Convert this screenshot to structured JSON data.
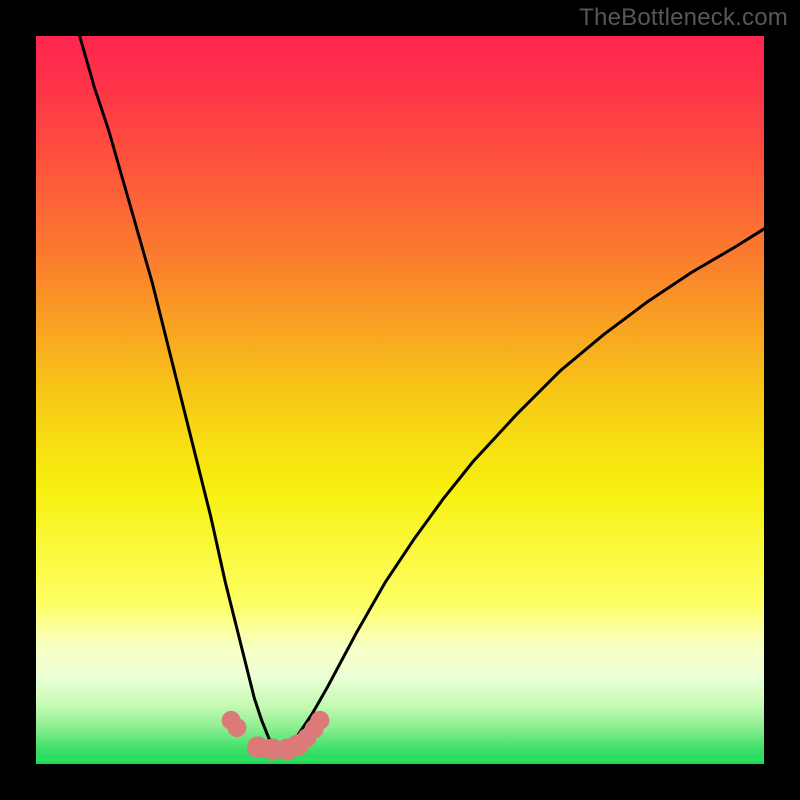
{
  "watermark": "TheBottleneck.com",
  "colors": {
    "frame": "#000000",
    "curve": "#000000",
    "overlay_pink": "#DB7A79",
    "green_line": "#2EE062"
  },
  "chart_data": {
    "type": "line",
    "title": "",
    "xlabel": "",
    "ylabel": "",
    "x_range": [
      0,
      100
    ],
    "y_range": [
      0,
      100
    ],
    "notes": "Bottleneck-style V curve: steep descent from upper-left toward a minimum around x≈33, then logarithmic-like rise toward right. Background is a vertical gradient from red/pink (top, high bottleneck) through yellow (mid) to green (bottom, low bottleneck). Pink markers cluster near curve bottom; thin bright green line sits at the very bottom.",
    "background_gradient_stops": [
      {
        "offset": 0.0,
        "color": "#FF2650"
      },
      {
        "offset": 0.07,
        "color": "#FF3349"
      },
      {
        "offset": 0.3,
        "color": "#FB7B2E"
      },
      {
        "offset": 0.5,
        "color": "#F7CB16"
      },
      {
        "offset": 0.62,
        "color": "#F7F00E"
      },
      {
        "offset": 0.78,
        "color": "#FDFF64"
      },
      {
        "offset": 0.84,
        "color": "#F8FFC5"
      },
      {
        "offset": 0.88,
        "color": "#EBFFD6"
      },
      {
        "offset": 0.92,
        "color": "#C4FAB3"
      },
      {
        "offset": 0.95,
        "color": "#8CEE8F"
      },
      {
        "offset": 0.975,
        "color": "#48E26E"
      },
      {
        "offset": 1.0,
        "color": "#17D851"
      }
    ],
    "series": [
      {
        "name": "bottleneck-curve",
        "x": [
          6,
          8,
          10,
          12,
          14,
          16,
          18,
          20,
          22,
          24,
          26,
          28,
          30,
          31,
          32,
          33,
          34,
          35,
          36,
          38,
          40,
          44,
          48,
          52,
          56,
          60,
          66,
          72,
          78,
          84,
          90,
          96,
          100
        ],
        "y": [
          100,
          93,
          87,
          80,
          73,
          66,
          58,
          50,
          42,
          34,
          25,
          17,
          9,
          6,
          3.5,
          2.3,
          2.3,
          3,
          4,
          7,
          10.5,
          18,
          25,
          31,
          36.5,
          41.5,
          48,
          54,
          59,
          63.5,
          67.5,
          71,
          73.5
        ]
      }
    ],
    "overlay_markers": [
      {
        "x": 26.8,
        "y": 6.0,
        "r": 1.3
      },
      {
        "x": 27.6,
        "y": 5.0,
        "r": 1.3
      },
      {
        "x": 30.5,
        "y": 2.3,
        "r": 1.5
      },
      {
        "x": 32.5,
        "y": 2.0,
        "r": 1.5
      },
      {
        "x": 34.5,
        "y": 2.0,
        "r": 1.5
      },
      {
        "x": 36.0,
        "y": 2.6,
        "r": 1.5
      },
      {
        "x": 37.2,
        "y": 3.6,
        "r": 1.3
      },
      {
        "x": 38.2,
        "y": 4.8,
        "r": 1.3
      },
      {
        "x": 39.0,
        "y": 6.0,
        "r": 1.3
      }
    ],
    "green_baseline_y": 0.6
  }
}
